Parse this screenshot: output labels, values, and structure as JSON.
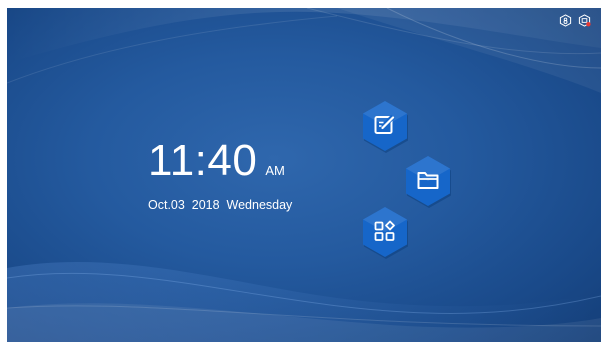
{
  "colors": {
    "background": "#245a9f",
    "hex_button": "#1565c8",
    "text": "#ffffff"
  },
  "status_bar": {
    "icons": [
      "usb-debug-icon",
      "app-notification-icon"
    ]
  },
  "clock": {
    "time": "11:40",
    "ampm": "AM",
    "date": "Oct.03  2018  Wednesday"
  },
  "shortcuts": [
    {
      "name": "note-edit-shortcut",
      "icon": "edit-icon"
    },
    {
      "name": "file-manager-shortcut",
      "icon": "folder-icon"
    },
    {
      "name": "apps-shortcut",
      "icon": "apps-grid-icon"
    }
  ]
}
